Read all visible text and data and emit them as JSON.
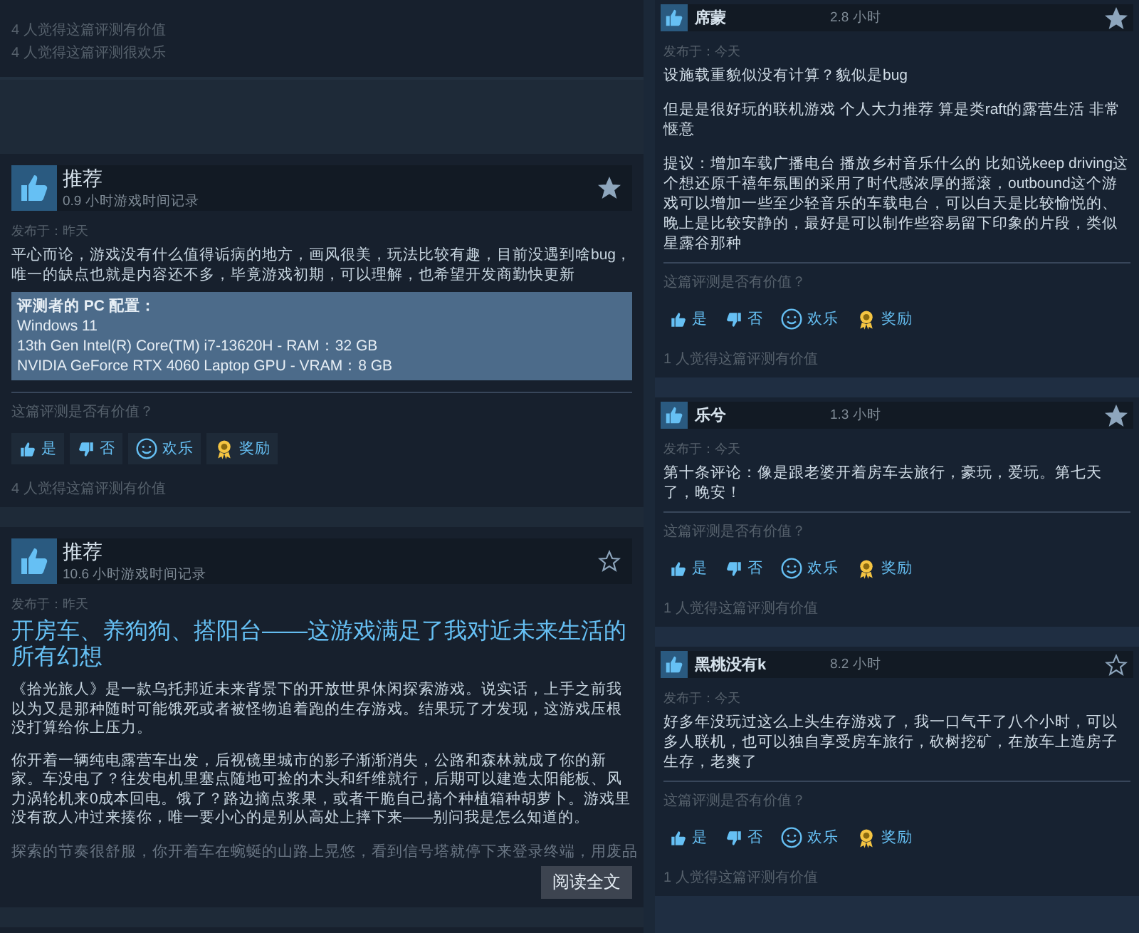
{
  "left_column": {
    "top_counts": [
      "4 人觉得这篇评测有价值",
      "4 人觉得这篇评测很欢乐"
    ],
    "reviews": [
      {
        "verdict": "推荐",
        "playtime": "0.9 小时游戏时间记录",
        "starred": true,
        "posted": "发布于：昨天",
        "paragraphs": [
          "平心而论，游戏没有什么值得诟病的地方，画风很美，玩法比较有趣，目前没遇到啥bug，唯一的缺点也就是内容还不多，毕竟游戏初期，可以理解，也希望开发商勤快更新"
        ],
        "pc_config": {
          "label": "评测者的 PC 配置：",
          "lines": [
            "Windows 11",
            "13th Gen Intel(R) Core(TM) i7-13620H - RAM：32 GB",
            "NVIDIA GeForce RTX 4060 Laptop GPU - VRAM：8 GB"
          ]
        },
        "helpful_question": "这篇评测是否有价值？",
        "votes": [
          {
            "kind": "yes",
            "label": "是"
          },
          {
            "kind": "no",
            "label": "否"
          },
          {
            "kind": "funny",
            "label": "欢乐"
          },
          {
            "kind": "award",
            "label": "奖励"
          }
        ],
        "counts": [
          "4 人觉得这篇评测有价值"
        ]
      },
      {
        "verdict": "推荐",
        "playtime": "10.6 小时游戏时间记录",
        "starred": false,
        "posted": "发布于：昨天",
        "title": "开房车、养狗狗、搭阳台——这游戏满足了我对近未来生活的所有幻想",
        "paragraphs": [
          "《拾光旅人》是一款乌托邦近未来背景下的开放世界休闲探索游戏。说实话，上手之前我以为又是那种随时可能饿死或者被怪物追着跑的生存游戏。结果玩了才发现，这游戏压根没打算给你上压力。",
          "你开着一辆纯电露营车出发，后视镜里城市的影子渐渐消失，公路和森林就成了你的新家。车没电了？往发电机里塞点随地可捡的木头和纤维就行，后期可以建造太阳能板、风力涡轮机来0成本回电。饿了？路边摘点浆果，或者干脆自己搞个种植箱种胡萝卜。游戏里没有敌人冲过来揍你，唯一要小心的是别从高处上摔下来——别问我是怎么知道的。"
        ],
        "faded_excerpt": "探索的节奏很舒服，你开着车在蜿蜒的山路上晃悠，看到信号塔就停下来登录终端，用废品",
        "read_more": "阅读全文"
      }
    ]
  },
  "right_column": {
    "reviews": [
      {
        "name": "席蒙",
        "playtime": "2.8 小时",
        "starred": true,
        "posted": "发布于：今天",
        "paragraphs": [
          "设施载重貌似没有计算？貌似是bug",
          "但是是很好玩的联机游戏 个人大力推荐 算是类raft的露营生活 非常惬意",
          "提议：增加车载广播电台 播放乡村音乐什么的 比如说keep driving这个想还原千禧年氛围的采用了时代感浓厚的摇滚，outbound这个游戏可以增加一些至少轻音乐的车载电台，可以白天是比较愉悦的、晚上是比较安静的，最好是可以制作些容易留下印象的片段，类似星露谷那种"
        ],
        "helpful_question": "这篇评测是否有价值？",
        "votes": [
          {
            "kind": "yes",
            "label": "是"
          },
          {
            "kind": "no",
            "label": "否"
          },
          {
            "kind": "funny",
            "label": "欢乐"
          },
          {
            "kind": "award",
            "label": "奖励"
          }
        ],
        "counts": [
          "1 人觉得这篇评测有价值"
        ]
      },
      {
        "name": "乐兮",
        "playtime": "1.3 小时",
        "starred": true,
        "posted": "发布于：今天",
        "paragraphs": [
          "第十条评论：像是跟老婆开着房车去旅行，豪玩，爱玩。第七天了，晚安！"
        ],
        "helpful_question": "这篇评测是否有价值？",
        "votes": [
          {
            "kind": "yes",
            "label": "是"
          },
          {
            "kind": "no",
            "label": "否"
          },
          {
            "kind": "funny",
            "label": "欢乐"
          },
          {
            "kind": "award",
            "label": "奖励"
          }
        ],
        "counts": [
          "1 人觉得这篇评测有价值"
        ]
      },
      {
        "name": "黑桃没有k",
        "playtime": "8.2 小时",
        "starred": false,
        "posted": "发布于：今天",
        "paragraphs": [
          "好多年没玩过这么上头生存游戏了，我一口气干了八个小时，可以多人联机，也可以独自享受房车旅行，砍树挖矿，在放车上造房子生存，老爽了"
        ],
        "helpful_question": "这篇评测是否有价值？",
        "votes": [
          {
            "kind": "yes",
            "label": "是"
          },
          {
            "kind": "no",
            "label": "否"
          },
          {
            "kind": "funny",
            "label": "欢乐"
          },
          {
            "kind": "award",
            "label": "奖励"
          }
        ],
        "counts": [
          "1 人觉得这篇评测有价值"
        ]
      }
    ]
  }
}
